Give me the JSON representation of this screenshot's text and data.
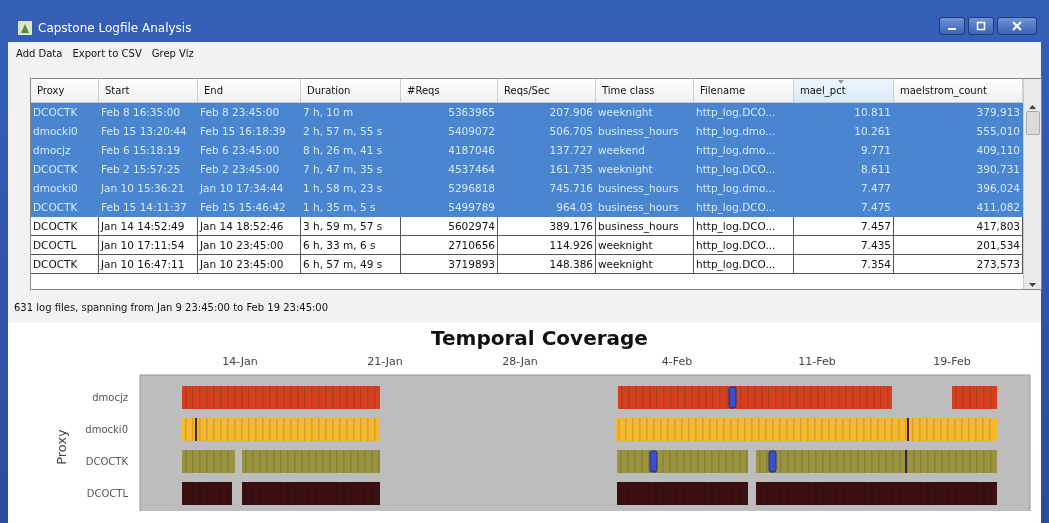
{
  "window": {
    "title": "Capstone Logfile Analysis"
  },
  "menu": [
    "Add Data",
    "Export to CSV",
    "Grep Viz"
  ],
  "table": {
    "columns": [
      {
        "label": "Proxy",
        "sorted": false
      },
      {
        "label": "Start",
        "sorted": false
      },
      {
        "label": "End",
        "sorted": false
      },
      {
        "label": "Duration",
        "sorted": false
      },
      {
        "label": "#Reqs",
        "sorted": false
      },
      {
        "label": "Reqs/Sec",
        "sorted": false
      },
      {
        "label": "Time class",
        "sorted": false
      },
      {
        "label": "Filename",
        "sorted": false
      },
      {
        "label": "mael_pct",
        "sorted": true
      },
      {
        "label": "maelstrom_count",
        "sorted": false
      }
    ],
    "rows": [
      {
        "selected": true,
        "cells": [
          "DCOCTK",
          "Feb 8 16:35:00",
          "Feb 8 23:45:00",
          "7 h, 10 m",
          "5363965",
          "207.906",
          "weeknight",
          "http_log.DCO...",
          "10.811",
          "379,913"
        ]
      },
      {
        "selected": true,
        "cells": [
          "dmocki0",
          "Feb 15 13:20:44",
          "Feb 15 16:18:39",
          "2 h, 57 m, 55 s",
          "5409072",
          "506.705",
          "business_hours",
          "http_log.dmo...",
          "10.261",
          "555,010"
        ]
      },
      {
        "selected": true,
        "cells": [
          "dmocjz",
          "Feb 6 15:18:19",
          "Feb 6 23:45:00",
          "8 h, 26 m, 41 s",
          "4187046",
          "137.727",
          "weekend",
          "http_log.dmo...",
          "9.771",
          "409,110"
        ]
      },
      {
        "selected": true,
        "cells": [
          "DCOCTK",
          "Feb 2 15:57:25",
          "Feb 2 23:45:00",
          "7 h, 47 m, 35 s",
          "4537464",
          "161.735",
          "weeknight",
          "http_log.DCO...",
          "8.611",
          "390,731"
        ]
      },
      {
        "selected": true,
        "cells": [
          "dmocki0",
          "Jan 10 15:36:21",
          "Jan 10 17:34:44",
          "1 h, 58 m, 23 s",
          "5296818",
          "745.716",
          "business_hours",
          "http_log.dmo...",
          "7.477",
          "396,024"
        ]
      },
      {
        "selected": true,
        "cells": [
          "DCOCTK",
          "Feb 15 14:11:37",
          "Feb 15 15:46:42",
          "1 h, 35 m, 5 s",
          "5499789",
          "964.03",
          "business_hours",
          "http_log.DCO...",
          "7.475",
          "411,082"
        ]
      },
      {
        "selected": false,
        "cells": [
          "DCOCTK",
          "Jan 14 14:52:49",
          "Jan 14 18:52:46",
          "3 h, 59 m, 57 s",
          "5602974",
          "389.176",
          "business_hours",
          "http_log.DCO...",
          "7.457",
          "417,803"
        ]
      },
      {
        "selected": false,
        "cells": [
          "DCOCTL",
          "Jan 10 17:11:54",
          "Jan 10 23:45:00",
          "6 h, 33 m, 6 s",
          "2710656",
          "114.926",
          "weeknight",
          "http_log.DCO...",
          "7.435",
          "201,534"
        ]
      },
      {
        "selected": false,
        "cells": [
          "DCOCTK",
          "Jan 10 16:47:11",
          "Jan 10 23:45:00",
          "6 h, 57 m, 49 s",
          "3719893",
          "148.386",
          "weeknight",
          "http_log.DCO...",
          "7.354",
          "273,573"
        ]
      }
    ]
  },
  "status": "631 log files, spanning from Jan 9 23:45:00 to Feb 19 23:45:00",
  "coverage": {
    "title": "Temporal Coverage",
    "ylabel": "Proxy",
    "xticks": [
      "14-Jan",
      "21-Jan",
      "28-Jan",
      "4-Feb",
      "11-Feb",
      "19-Feb"
    ],
    "rows": [
      {
        "name": "dmocjz",
        "color": "#d6401f"
      },
      {
        "name": "dmocki0",
        "color": "#f5b82e"
      },
      {
        "name": "DCOCTK",
        "color": "#9a9440"
      },
      {
        "name": "DCOCTL",
        "color": "#3c1010"
      }
    ]
  }
}
